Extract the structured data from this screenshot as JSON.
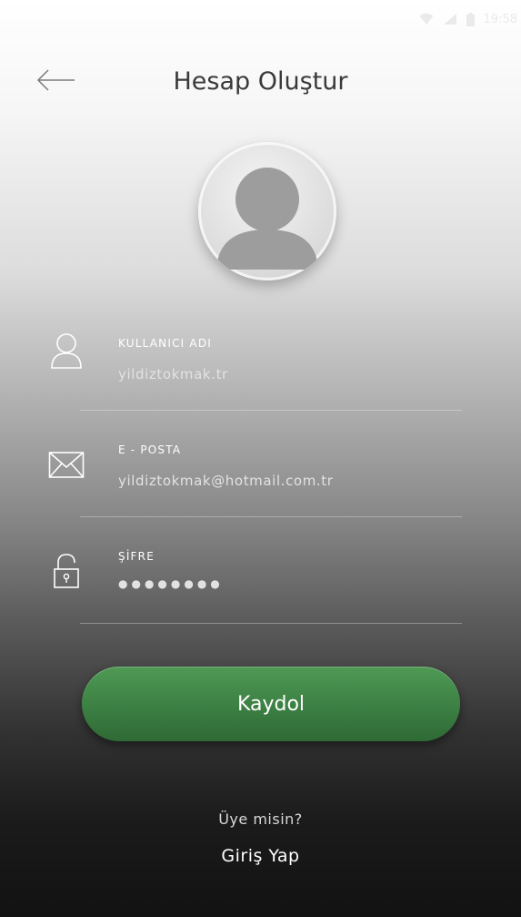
{
  "status_bar": {
    "time": "19:58",
    "icons": [
      "wifi-icon",
      "signal-icon",
      "battery-icon"
    ]
  },
  "header": {
    "back_icon": "arrow-left-icon",
    "title": "Hesap Oluştur"
  },
  "avatar": {
    "icon": "user-placeholder-icon"
  },
  "form": {
    "fields": [
      {
        "icon": "user-icon",
        "label": "KULLANICI ADI",
        "value": "yildiztokmak.tr"
      },
      {
        "icon": "envelope-icon",
        "label": "E - POSTA",
        "value": "yildiztokmak@hotmail.com.tr"
      },
      {
        "icon": "padlock-icon",
        "label": "ŞİFRE",
        "value": "●●●●●●●●"
      }
    ]
  },
  "register_button": {
    "label": "Kaydol",
    "color": "#3f8446"
  },
  "footer": {
    "member_question": "Üye misin?",
    "login_link": "Giriş Yap"
  }
}
